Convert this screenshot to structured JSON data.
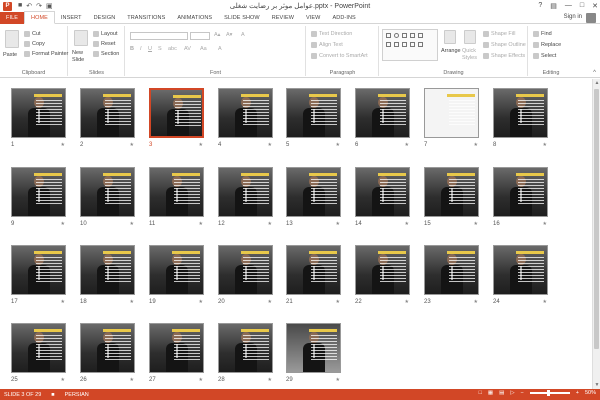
{
  "app": {
    "window_title": "عوامل موثر بر رضایت شغلی.pptx - PowerPoint",
    "app_icon": "P",
    "signin": "Sign in"
  },
  "tabs": [
    "FILE",
    "HOME",
    "INSERT",
    "DESIGN",
    "TRANSITIONS",
    "ANIMATIONS",
    "SLIDE SHOW",
    "REVIEW",
    "VIEW",
    "ADD-INS"
  ],
  "ribbon": {
    "clipboard": {
      "label": "Clipboard",
      "paste": "Paste",
      "cut": "Cut",
      "copy": "Copy",
      "format_painter": "Format Painter"
    },
    "slides": {
      "label": "Slides",
      "new_slide": "New Slide",
      "layout": "Layout",
      "reset": "Reset",
      "section": "Section"
    },
    "font": {
      "label": "Font"
    },
    "paragraph": {
      "label": "Paragraph",
      "text_direction": "Text Direction",
      "align_text": "Align Text",
      "convert_smartart": "Convert to SmartArt"
    },
    "drawing": {
      "label": "Drawing",
      "arrange": "Arrange",
      "quick_styles": "Quick Styles",
      "shape_fill": "Shape Fill",
      "shape_outline": "Shape Outline",
      "shape_effects": "Shape Effects"
    },
    "editing": {
      "label": "Editing",
      "find": "Find",
      "replace": "Replace",
      "select": "Select"
    }
  },
  "slides": [
    {
      "num": "1",
      "variant": "dark"
    },
    {
      "num": "2",
      "variant": "dark"
    },
    {
      "num": "3",
      "variant": "dark",
      "selected": true
    },
    {
      "num": "4",
      "variant": "dark"
    },
    {
      "num": "5",
      "variant": "dark"
    },
    {
      "num": "6",
      "variant": "dark"
    },
    {
      "num": "7",
      "variant": "white"
    },
    {
      "num": "8",
      "variant": "dark"
    },
    {
      "num": "9",
      "variant": "dark"
    },
    {
      "num": "10",
      "variant": "dark"
    },
    {
      "num": "11",
      "variant": "dark"
    },
    {
      "num": "12",
      "variant": "dark"
    },
    {
      "num": "13",
      "variant": "dark"
    },
    {
      "num": "14",
      "variant": "dark"
    },
    {
      "num": "15",
      "variant": "dark"
    },
    {
      "num": "16",
      "variant": "dark"
    },
    {
      "num": "17",
      "variant": "dark"
    },
    {
      "num": "18",
      "variant": "dark"
    },
    {
      "num": "19",
      "variant": "dark"
    },
    {
      "num": "20",
      "variant": "dark"
    },
    {
      "num": "21",
      "variant": "dark"
    },
    {
      "num": "22",
      "variant": "dark"
    },
    {
      "num": "23",
      "variant": "dark"
    },
    {
      "num": "24",
      "variant": "dark"
    },
    {
      "num": "25",
      "variant": "dark"
    },
    {
      "num": "26",
      "variant": "dark"
    },
    {
      "num": "27",
      "variant": "dark"
    },
    {
      "num": "28",
      "variant": "dark"
    },
    {
      "num": "29",
      "variant": "photo"
    }
  ],
  "status": {
    "slide_info": "SLIDE 3 OF 29",
    "language": "PERSIAN",
    "zoom": "50%"
  },
  "colors": {
    "accent": "#d24726",
    "selected_border": "#d24726"
  }
}
